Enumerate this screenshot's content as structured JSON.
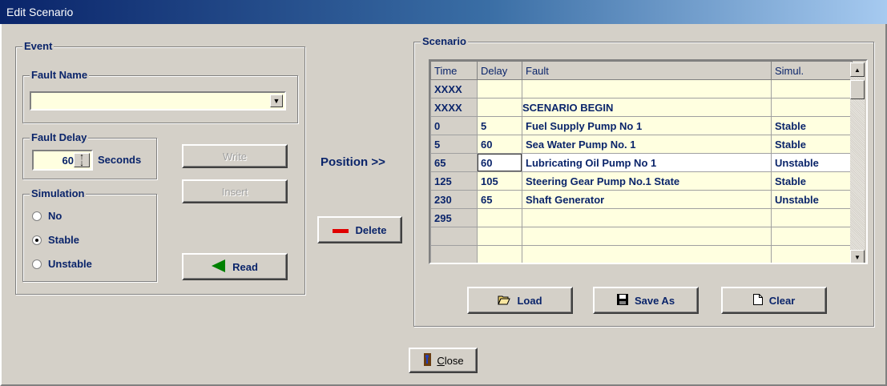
{
  "window": {
    "title": "Edit Scenario"
  },
  "event": {
    "legend": "Event",
    "fault_name_legend": "Fault Name",
    "fault_name_value": "",
    "fault_delay_legend": "Fault Delay",
    "fault_delay_value": "60",
    "fault_delay_unit": "Seconds",
    "simulation_legend": "Simulation",
    "simulation_options": [
      "No",
      "Stable",
      "Unstable"
    ],
    "simulation_selected": "Stable"
  },
  "buttons": {
    "write": "Write",
    "insert": "Insert",
    "read": "Read",
    "delete": "Delete",
    "load": "Load",
    "save_as": "Save As",
    "clear": "Clear",
    "close_mnemonic": "C",
    "close_rest": "lose"
  },
  "position_label": "Position >>",
  "scenario": {
    "legend": "Scenario",
    "columns": [
      "Time",
      "Delay",
      "Fault",
      "Simul."
    ],
    "rows": [
      [
        "XXXX",
        "",
        "",
        ""
      ],
      [
        "XXXX",
        "",
        "SCENARIO BEGIN",
        ""
      ],
      [
        "0",
        "5",
        "Fuel Supply Pump No 1",
        "Stable"
      ],
      [
        "5",
        "60",
        "Sea Water Pump No. 1",
        "Stable"
      ],
      [
        "65",
        "60",
        "Lubricating Oil Pump No 1",
        "Unstable"
      ],
      [
        "125",
        "105",
        "Steering Gear Pump No.1 State",
        "Stable"
      ],
      [
        "230",
        "65",
        "Shaft Generator",
        "Unstable"
      ],
      [
        "295",
        "",
        "",
        ""
      ],
      [
        "",
        "",
        "",
        ""
      ],
      [
        "",
        "",
        "",
        ""
      ]
    ]
  },
  "icons": {
    "combo": "chevron-down-icon",
    "spin": "spin-arrows-icon",
    "read": "left-arrow-icon",
    "delete": "minus-icon",
    "load": "open-folder-icon",
    "save": "floppy-disk-icon",
    "clear": "blank-page-icon",
    "close": "exit-door-icon"
  },
  "colors": {
    "accent_text": "#0a246a",
    "cell_bg": "#ffffe0",
    "read_arrow": "#008000",
    "delete_icon": "#e00000"
  }
}
